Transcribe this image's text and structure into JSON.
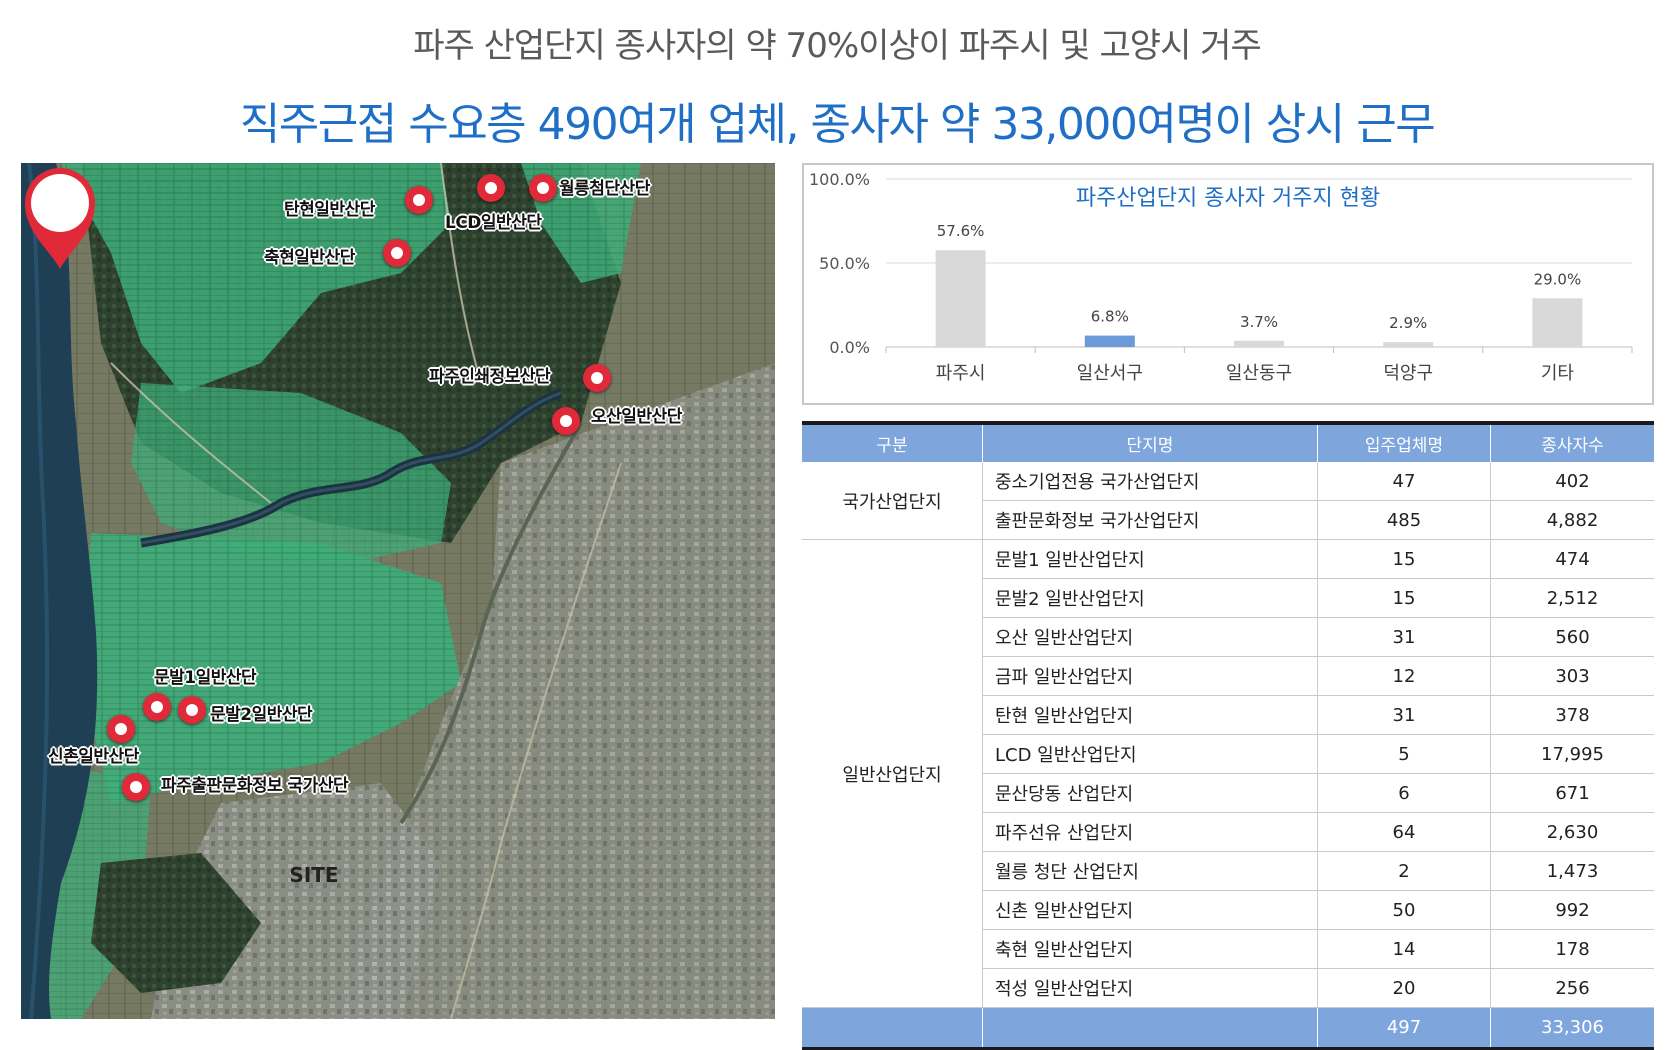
{
  "header": {
    "title1": "파주 산업단지 종사자의 약 70%이상이 파주시 및 고양시 거주",
    "title2": "직주근접 수요층 490여개 업체, 종사자 약 33,000여명이 상시 근무"
  },
  "map": {
    "labels": {
      "woreung": "월릉첨단산단",
      "tanhyeon": "탄현일반산단",
      "lcd": "LCD일반산단",
      "chukhyeon": "축현일반산단",
      "printing": "파주인쇄정보산단",
      "osan": "오산일반산단",
      "munbal1": "문발1일반산단",
      "munbal2": "문발2일반산단",
      "sinchon": "신촌일반산단",
      "publishing": "파주출판문화정보 국가산단"
    },
    "site_label": "SITE",
    "colors": {
      "pin": "#e02a3a",
      "field": "#3fae7a",
      "river": "#1f3f55"
    }
  },
  "chart_data": {
    "type": "bar",
    "title": "파주산업단지 종사자 거주지 현황",
    "categories": [
      "파주시",
      "일산서구",
      "일산동구",
      "덕양구",
      "기타"
    ],
    "values": [
      57.6,
      6.8,
      3.7,
      2.9,
      29.0
    ],
    "value_labels": [
      "57.6%",
      "6.8%",
      "3.7%",
      "2.9%",
      "29.0%"
    ],
    "y_ticks": [
      "100.0%",
      "50.0%",
      "0.0%"
    ],
    "ylim": [
      0,
      100
    ],
    "colors": [
      "#d9d9d9",
      "#6a9ad8",
      "#d9d9d9",
      "#d9d9d9",
      "#d9d9d9"
    ]
  },
  "table": {
    "headers": [
      "구분",
      "단지명",
      "입주업체명",
      "종사자수"
    ],
    "groups": {
      "national": "국가산업단지",
      "general": "일반산업단지"
    },
    "rows": [
      {
        "name": "중소기업전용 국가산업단지",
        "companies": "47",
        "workers": "402"
      },
      {
        "name": "출판문화정보 국가산업단지",
        "companies": "485",
        "workers": "4,882"
      },
      {
        "name": "문발1 일반산업단지",
        "companies": "15",
        "workers": "474"
      },
      {
        "name": "문발2 일반산업단지",
        "companies": "15",
        "workers": "2,512"
      },
      {
        "name": "오산 일반산업단지",
        "companies": "31",
        "workers": "560"
      },
      {
        "name": "금파 일반산업단지",
        "companies": "12",
        "workers": "303"
      },
      {
        "name": "탄현 일반산업단지",
        "companies": "31",
        "workers": "378"
      },
      {
        "name": "LCD 일반산업단지",
        "companies": "5",
        "workers": "17,995"
      },
      {
        "name": "문산당동 산업단지",
        "companies": "6",
        "workers": "671"
      },
      {
        "name": "파주선유 산업단지",
        "companies": "64",
        "workers": "2,630"
      },
      {
        "name": "월릉 청단 산업단지",
        "companies": "2",
        "workers": "1,473"
      },
      {
        "name": "신촌 일반산업단지",
        "companies": "50",
        "workers": "992"
      },
      {
        "name": "축현 일반산업단지",
        "companies": "14",
        "workers": "178"
      },
      {
        "name": "적성 일반산업단지",
        "companies": "20",
        "workers": "256"
      }
    ],
    "total": {
      "companies": "497",
      "workers": "33,306"
    }
  }
}
